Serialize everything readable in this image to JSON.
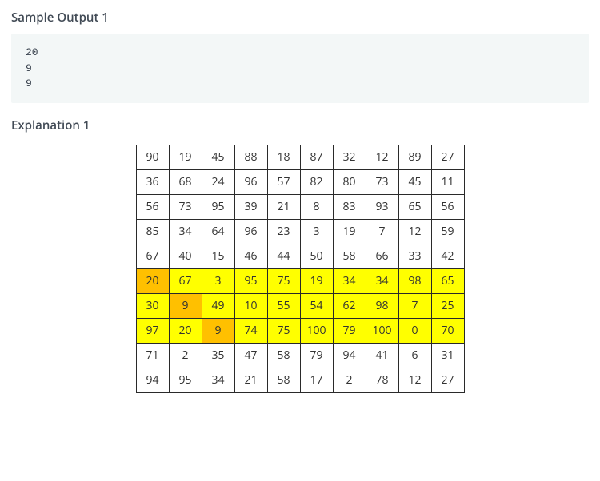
{
  "labels": {
    "sample_output_heading": "Sample Output 1",
    "explanation_heading": "Explanation 1"
  },
  "sample_output_lines": [
    "20",
    "9",
    "9"
  ],
  "highlight_colors": {
    "yellow": "#ffff00",
    "orange": "#ffc000"
  },
  "chart_data": {
    "type": "table",
    "title": "Explanation 1 grid",
    "rows": 10,
    "cols": 10,
    "highlighted_rows_yellow": [
      5,
      6,
      7
    ],
    "orange_cells": [
      [
        5,
        0
      ],
      [
        6,
        1
      ],
      [
        7,
        2
      ]
    ],
    "values": [
      [
        90,
        19,
        45,
        88,
        18,
        87,
        32,
        12,
        89,
        27
      ],
      [
        36,
        68,
        24,
        96,
        57,
        82,
        80,
        73,
        45,
        11
      ],
      [
        56,
        73,
        95,
        39,
        21,
        8,
        83,
        93,
        65,
        56
      ],
      [
        85,
        34,
        64,
        96,
        23,
        3,
        19,
        7,
        12,
        59
      ],
      [
        67,
        40,
        15,
        46,
        44,
        50,
        58,
        66,
        33,
        42
      ],
      [
        20,
        67,
        3,
        95,
        75,
        19,
        34,
        34,
        98,
        65
      ],
      [
        30,
        9,
        49,
        10,
        55,
        54,
        62,
        98,
        7,
        25
      ],
      [
        97,
        20,
        9,
        74,
        75,
        100,
        79,
        100,
        0,
        70
      ],
      [
        71,
        2,
        35,
        47,
        58,
        79,
        94,
        41,
        6,
        31
      ],
      [
        94,
        95,
        34,
        21,
        58,
        17,
        2,
        78,
        12,
        27
      ]
    ]
  }
}
